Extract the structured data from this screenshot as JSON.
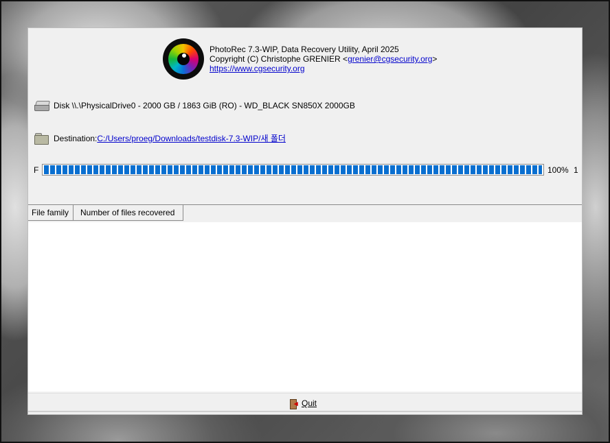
{
  "app": {
    "title_line": "PhotoRec 7.3-WIP, Data Recovery Utility, April 2025",
    "copyright_prefix": "Copyright (C) Christophe GRENIER <",
    "email": "grenier@cgsecurity.org",
    "copyright_suffix": ">",
    "website": "https://www.cgsecurity.org"
  },
  "disk": {
    "text": "Disk \\\\.\\PhysicalDrive0 - 2000 GB / 1863 GiB (RO) - WD_BLACK SN850X 2000GB",
    "icon": "hard-drive-icon"
  },
  "destination": {
    "label": "Destination: ",
    "path": "C:/Users/proeg/Downloads/testdisk-7.3-WIP/새 폴더",
    "icon": "folder-icon"
  },
  "progress": {
    "label": "F",
    "fraction": 1.0,
    "percent_text": "100%",
    "count_text": "1",
    "color": "#0a6fd0"
  },
  "table": {
    "columns": [
      "File family",
      "Number of files recovered"
    ],
    "rows": []
  },
  "footer": {
    "quit_label": "Quit",
    "quit_icon": "exit-door-icon"
  }
}
